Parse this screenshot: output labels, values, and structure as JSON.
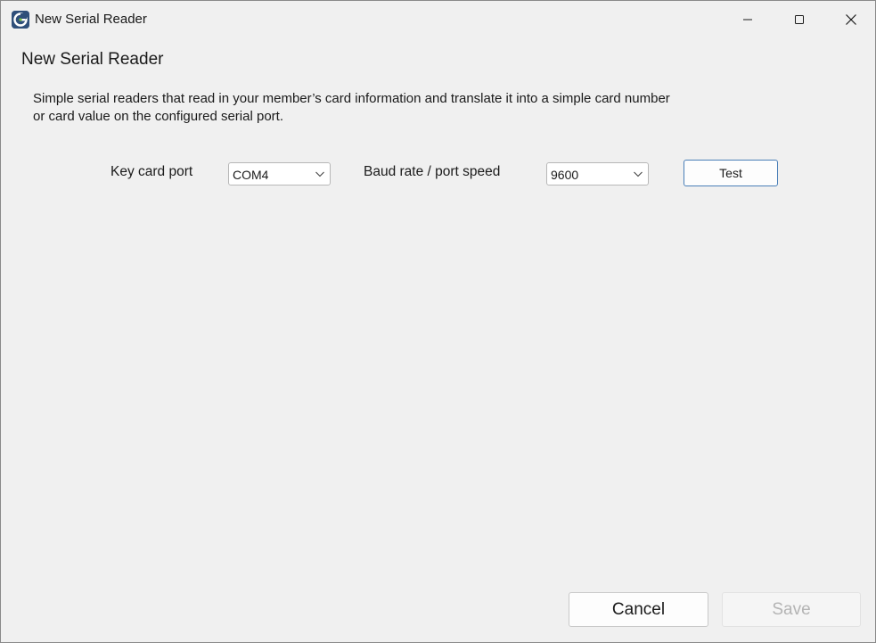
{
  "window": {
    "title": "New Serial Reader",
    "icon": "app-logo-icon",
    "controls": [
      "minimize-icon",
      "maximize-icon",
      "close-icon"
    ]
  },
  "page": {
    "heading": "New Serial Reader",
    "description_line1": "Simple serial readers that read in your member’s card information and translate it into a simple card number",
    "description_line2": "or card value on the configured serial port."
  },
  "form": {
    "key_card_port_label": "Key card port",
    "key_card_port_value": "COM4",
    "baud_rate_label": "Baud rate / port speed",
    "baud_rate_value": "9600",
    "test_button": "Test"
  },
  "footer": {
    "cancel_button": "Cancel",
    "save_button": "Save",
    "save_enabled": false
  },
  "colors": {
    "background": "#f0f0f0",
    "accent_border": "#4a7fb8",
    "disabled_text": "#b4b4b4"
  }
}
